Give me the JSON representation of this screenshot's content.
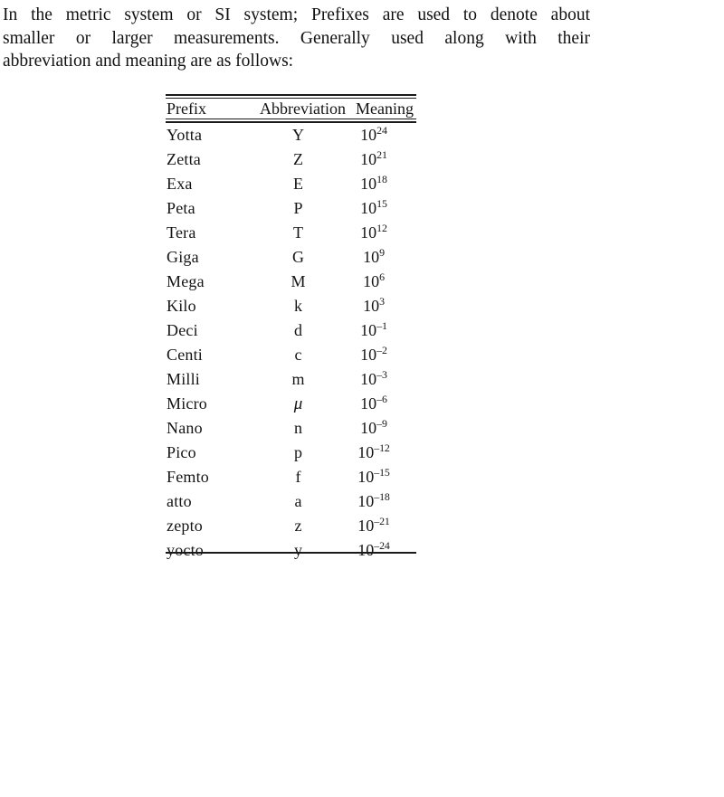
{
  "document": {
    "intro": {
      "line1": "In the metric system or SI system; Prefixes are used to denote about",
      "line2": "smaller or larger measurements. Generally used along with their",
      "line3": "abbreviation and meaning are as follows:"
    },
    "table": {
      "headers": {
        "prefix": "Prefix",
        "abbreviation": "Abbreviation",
        "meaning": "Meaning"
      },
      "rows": [
        {
          "prefix": "Yotta",
          "abbreviation": "Y",
          "base": "10",
          "exponent": "24",
          "meaning": "10²⁴"
        },
        {
          "prefix": "Zetta",
          "abbreviation": "Z",
          "base": "10",
          "exponent": "21",
          "meaning": "10²¹"
        },
        {
          "prefix": "Exa",
          "abbreviation": "E",
          "base": "10",
          "exponent": "18",
          "meaning": "10¹⁸"
        },
        {
          "prefix": "Peta",
          "abbreviation": "P",
          "base": "10",
          "exponent": "15",
          "meaning": "10¹⁵"
        },
        {
          "prefix": "Tera",
          "abbreviation": "T",
          "base": "10",
          "exponent": "12",
          "meaning": "10¹²"
        },
        {
          "prefix": "Giga",
          "abbreviation": "G",
          "base": "10",
          "exponent": "9",
          "meaning": "10⁹"
        },
        {
          "prefix": "Mega",
          "abbreviation": "M",
          "base": "10",
          "exponent": "6",
          "meaning": "10⁶"
        },
        {
          "prefix": "Kilo",
          "abbreviation": "k",
          "base": "10",
          "exponent": "3",
          "meaning": "10³"
        },
        {
          "prefix": "Deci",
          "abbreviation": "d",
          "base": "10",
          "exponent": "–1",
          "meaning": "10⁻¹"
        },
        {
          "prefix": "Centi",
          "abbreviation": "c",
          "base": "10",
          "exponent": "–2",
          "meaning": "10⁻²"
        },
        {
          "prefix": "Milli",
          "abbreviation": "m",
          "base": "10",
          "exponent": "–3",
          "meaning": "10⁻³"
        },
        {
          "prefix": "Micro",
          "abbreviation": "μ",
          "base": "10",
          "exponent": "–6",
          "meaning": "10⁻⁶"
        },
        {
          "prefix": "Nano",
          "abbreviation": "n",
          "base": "10",
          "exponent": "–9",
          "meaning": "10⁻⁹"
        },
        {
          "prefix": "Pico",
          "abbreviation": "p",
          "base": "10",
          "exponent": "–12",
          "meaning": "10⁻¹²"
        },
        {
          "prefix": "Femto",
          "abbreviation": "f",
          "base": "10",
          "exponent": "–15",
          "meaning": "10⁻¹⁵"
        },
        {
          "prefix": "atto",
          "abbreviation": "a",
          "base": "10",
          "exponent": "–18",
          "meaning": "10⁻¹⁸"
        },
        {
          "prefix": "zepto",
          "abbreviation": "z",
          "base": "10",
          "exponent": "–21",
          "meaning": "10⁻²¹"
        },
        {
          "prefix": "yocto",
          "abbreviation": "y",
          "base": "10",
          "exponent": "–24",
          "meaning": "10⁻²⁴"
        }
      ]
    }
  }
}
